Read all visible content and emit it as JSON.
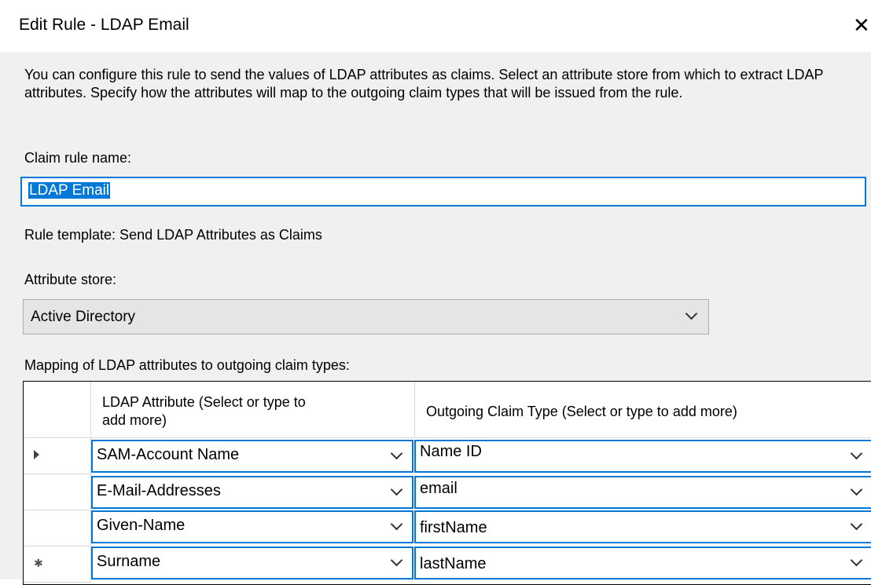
{
  "window": {
    "title": "Edit Rule - LDAP Email",
    "close_glyph": "✕"
  },
  "description": "You can configure this rule to send the values of LDAP attributes as claims. Select an attribute store from which to extract LDAP attributes. Specify how the attributes will map to the outgoing claim types that will be issued from the rule.",
  "rule_name": {
    "label": "Claim rule name:",
    "value": "LDAP Email"
  },
  "rule_template": "Rule template: Send LDAP Attributes as Claims",
  "attribute_store": {
    "label": "Attribute store:",
    "selected": "Active Directory"
  },
  "mapping": {
    "label": "Mapping of LDAP attributes to outgoing claim types:",
    "columns": {
      "ldap_line1": "LDAP Attribute (Select or type to",
      "ldap_line2": "add more)",
      "claim": "Outgoing Claim Type (Select or type to add more)"
    },
    "rows": [
      {
        "ldap": "SAM-Account Name",
        "claim": "Name ID",
        "marker": "current-row-icon"
      },
      {
        "ldap": "E-Mail-Addresses",
        "claim": "email",
        "marker": ""
      },
      {
        "ldap": "Given-Name",
        "claim": "firstName",
        "marker": ""
      },
      {
        "ldap": "Surname",
        "claim": "lastName",
        "marker": "new-row-icon"
      }
    ]
  },
  "colors": {
    "accent": "#0078d7",
    "dialog_bg": "#f0f0f0"
  }
}
